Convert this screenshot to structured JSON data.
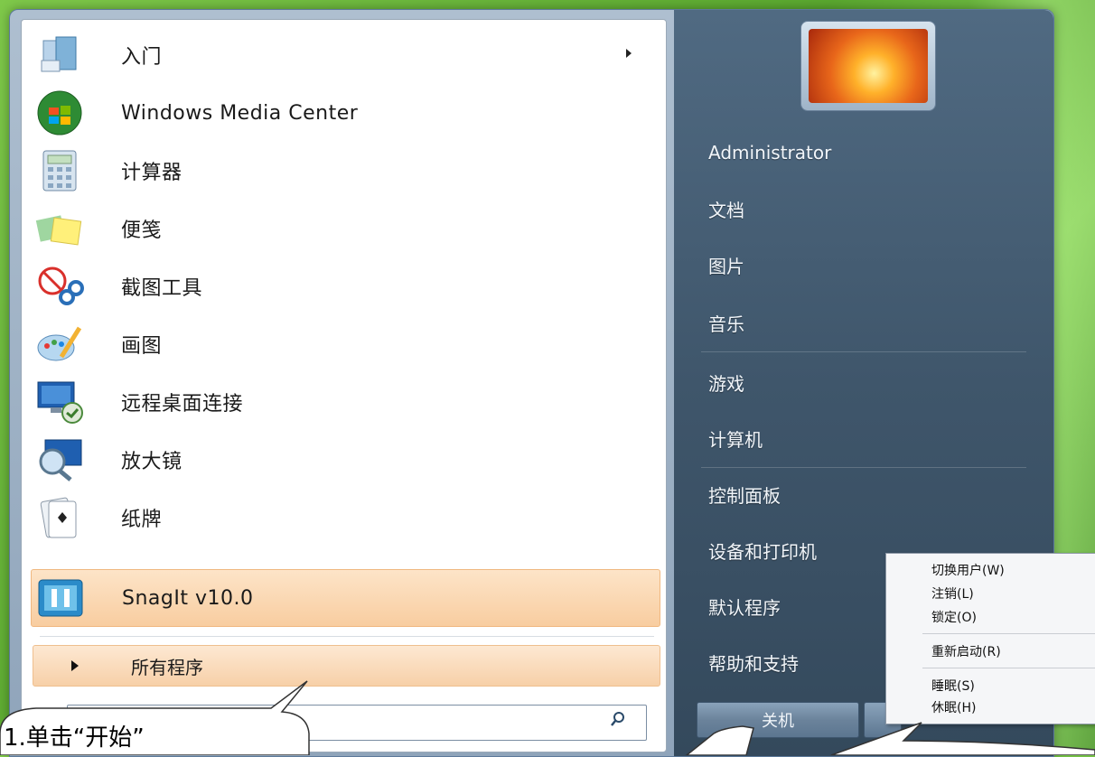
{
  "programs": [
    {
      "label": "入门",
      "icon": "getting-started-icon",
      "has_submenu": true
    },
    {
      "label": "Windows Media Center",
      "icon": "media-center-icon"
    },
    {
      "label": "计算器",
      "icon": "calculator-icon"
    },
    {
      "label": "便笺",
      "icon": "sticky-notes-icon"
    },
    {
      "label": "截图工具",
      "icon": "snipping-tool-icon"
    },
    {
      "label": "画图",
      "icon": "paint-icon"
    },
    {
      "label": "远程桌面连接",
      "icon": "remote-desktop-icon"
    },
    {
      "label": "放大镜",
      "icon": "magnifier-icon"
    },
    {
      "label": "纸牌",
      "icon": "solitaire-icon"
    },
    {
      "label": "SnagIt v10.0",
      "icon": "snagit-icon",
      "highlighted": true
    }
  ],
  "all_programs": "所有程序",
  "right_items": [
    "Administrator",
    "文档",
    "图片",
    "音乐",
    "游戏",
    "计算机",
    "控制面板",
    "设备和打印机",
    "默认程序",
    "帮助和支持"
  ],
  "shutdown_label": "关机",
  "context_menu": [
    "切换用户(W)",
    "注销(L)",
    "锁定(O)",
    "重新启动(R)",
    "睡眠(S)",
    "休眠(H)"
  ],
  "callout_text": "1.单击“开始”"
}
